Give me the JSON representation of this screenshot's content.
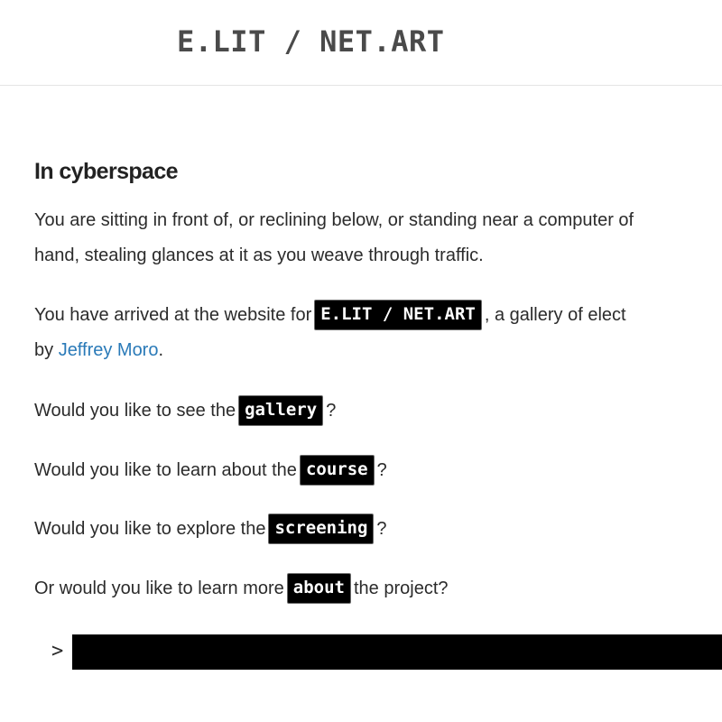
{
  "header": {
    "site_title": "E.LIT / NET.ART"
  },
  "main": {
    "heading": "In cyberspace",
    "intro": {
      "line1": "You are sitting in front of, or reclining below, or standing near a computer of",
      "line2": "hand, stealing glances at it as you weave through traffic."
    },
    "arrival": {
      "before": "You have arrived at the website for",
      "tag": "E.LIT / NET.ART",
      "after": ", a gallery of elect",
      "by": "by ",
      "author_link": "Jeffrey Moro",
      "end": "."
    },
    "options": [
      {
        "before": "Would you like to see the",
        "tag": "gallery",
        "after": "?"
      },
      {
        "before": "Would you like to learn about the",
        "tag": "course",
        "after": "?"
      },
      {
        "before": "Would you like to explore the",
        "tag": "screening",
        "after": "?"
      },
      {
        "before": "Or would you like to learn more",
        "tag": "about",
        "after": "the project?"
      }
    ]
  },
  "prompt": {
    "caret": ">",
    "value": ""
  },
  "colors": {
    "tag_background": "#000000",
    "tag_text": "#ffffff",
    "link": "#2a7ab8",
    "title_text": "#4a4a4a",
    "body_text": "#2b2b2b"
  }
}
